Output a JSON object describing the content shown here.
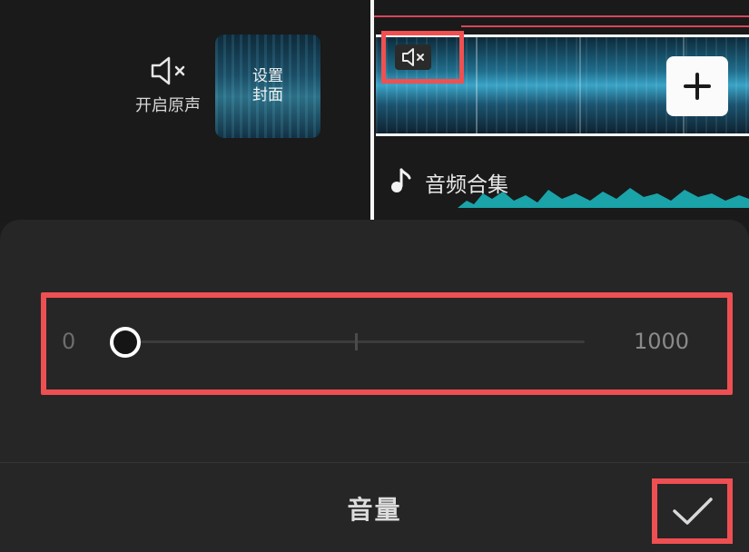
{
  "editor": {
    "mute_label": "开启原声",
    "cover_label_line1": "设置",
    "cover_label_line2": "封面",
    "audio_title": "音频合集"
  },
  "volume": {
    "min_label": "0",
    "max_label": "1000",
    "value": 0
  },
  "sheet": {
    "title": "音量"
  },
  "icons": {
    "mute": "speaker-mute-icon",
    "add": "plus-icon",
    "note": "music-note-icon",
    "confirm": "checkmark-icon"
  },
  "colors": {
    "highlight": "#ee4f52",
    "accent_wave": "#1aa3a8",
    "sheet_bg": "#262626"
  }
}
